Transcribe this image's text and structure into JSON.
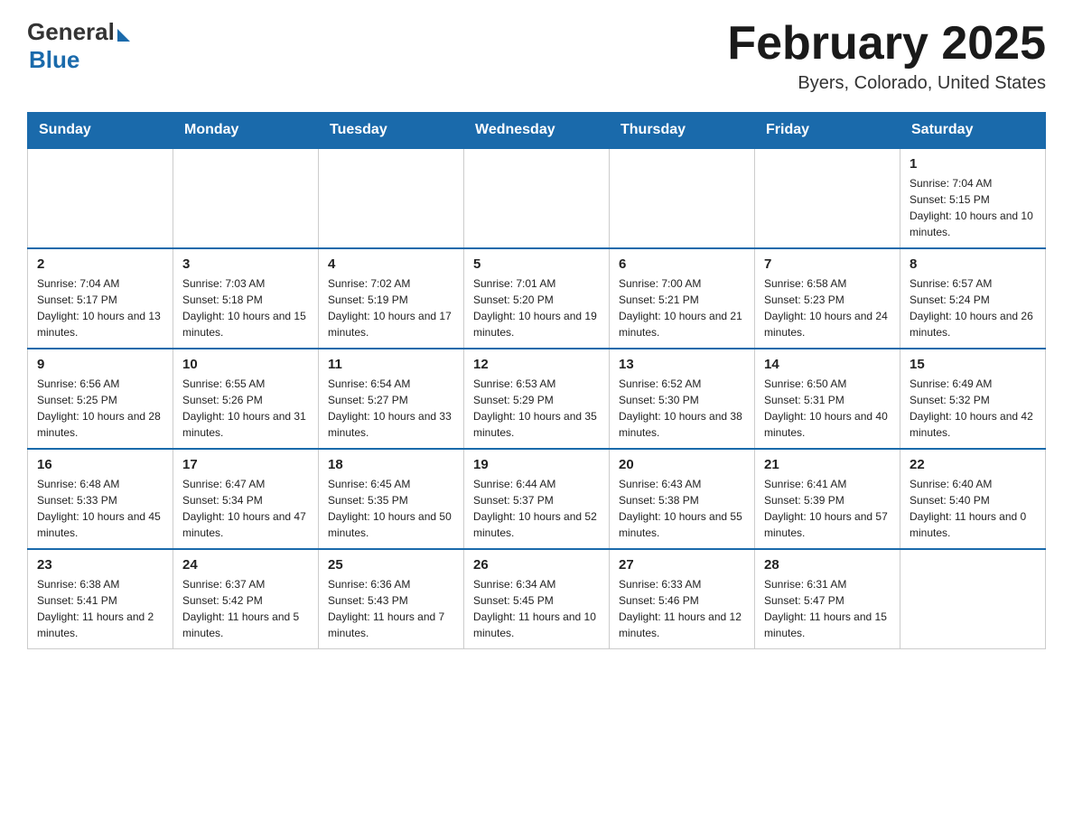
{
  "logo": {
    "general": "General",
    "blue": "Blue"
  },
  "title": "February 2025",
  "location": "Byers, Colorado, United States",
  "days_of_week": [
    "Sunday",
    "Monday",
    "Tuesday",
    "Wednesday",
    "Thursday",
    "Friday",
    "Saturday"
  ],
  "weeks": [
    [
      {
        "day": "",
        "info": ""
      },
      {
        "day": "",
        "info": ""
      },
      {
        "day": "",
        "info": ""
      },
      {
        "day": "",
        "info": ""
      },
      {
        "day": "",
        "info": ""
      },
      {
        "day": "",
        "info": ""
      },
      {
        "day": "1",
        "info": "Sunrise: 7:04 AM\nSunset: 5:15 PM\nDaylight: 10 hours and 10 minutes."
      }
    ],
    [
      {
        "day": "2",
        "info": "Sunrise: 7:04 AM\nSunset: 5:17 PM\nDaylight: 10 hours and 13 minutes."
      },
      {
        "day": "3",
        "info": "Sunrise: 7:03 AM\nSunset: 5:18 PM\nDaylight: 10 hours and 15 minutes."
      },
      {
        "day": "4",
        "info": "Sunrise: 7:02 AM\nSunset: 5:19 PM\nDaylight: 10 hours and 17 minutes."
      },
      {
        "day": "5",
        "info": "Sunrise: 7:01 AM\nSunset: 5:20 PM\nDaylight: 10 hours and 19 minutes."
      },
      {
        "day": "6",
        "info": "Sunrise: 7:00 AM\nSunset: 5:21 PM\nDaylight: 10 hours and 21 minutes."
      },
      {
        "day": "7",
        "info": "Sunrise: 6:58 AM\nSunset: 5:23 PM\nDaylight: 10 hours and 24 minutes."
      },
      {
        "day": "8",
        "info": "Sunrise: 6:57 AM\nSunset: 5:24 PM\nDaylight: 10 hours and 26 minutes."
      }
    ],
    [
      {
        "day": "9",
        "info": "Sunrise: 6:56 AM\nSunset: 5:25 PM\nDaylight: 10 hours and 28 minutes."
      },
      {
        "day": "10",
        "info": "Sunrise: 6:55 AM\nSunset: 5:26 PM\nDaylight: 10 hours and 31 minutes."
      },
      {
        "day": "11",
        "info": "Sunrise: 6:54 AM\nSunset: 5:27 PM\nDaylight: 10 hours and 33 minutes."
      },
      {
        "day": "12",
        "info": "Sunrise: 6:53 AM\nSunset: 5:29 PM\nDaylight: 10 hours and 35 minutes."
      },
      {
        "day": "13",
        "info": "Sunrise: 6:52 AM\nSunset: 5:30 PM\nDaylight: 10 hours and 38 minutes."
      },
      {
        "day": "14",
        "info": "Sunrise: 6:50 AM\nSunset: 5:31 PM\nDaylight: 10 hours and 40 minutes."
      },
      {
        "day": "15",
        "info": "Sunrise: 6:49 AM\nSunset: 5:32 PM\nDaylight: 10 hours and 42 minutes."
      }
    ],
    [
      {
        "day": "16",
        "info": "Sunrise: 6:48 AM\nSunset: 5:33 PM\nDaylight: 10 hours and 45 minutes."
      },
      {
        "day": "17",
        "info": "Sunrise: 6:47 AM\nSunset: 5:34 PM\nDaylight: 10 hours and 47 minutes."
      },
      {
        "day": "18",
        "info": "Sunrise: 6:45 AM\nSunset: 5:35 PM\nDaylight: 10 hours and 50 minutes."
      },
      {
        "day": "19",
        "info": "Sunrise: 6:44 AM\nSunset: 5:37 PM\nDaylight: 10 hours and 52 minutes."
      },
      {
        "day": "20",
        "info": "Sunrise: 6:43 AM\nSunset: 5:38 PM\nDaylight: 10 hours and 55 minutes."
      },
      {
        "day": "21",
        "info": "Sunrise: 6:41 AM\nSunset: 5:39 PM\nDaylight: 10 hours and 57 minutes."
      },
      {
        "day": "22",
        "info": "Sunrise: 6:40 AM\nSunset: 5:40 PM\nDaylight: 11 hours and 0 minutes."
      }
    ],
    [
      {
        "day": "23",
        "info": "Sunrise: 6:38 AM\nSunset: 5:41 PM\nDaylight: 11 hours and 2 minutes."
      },
      {
        "day": "24",
        "info": "Sunrise: 6:37 AM\nSunset: 5:42 PM\nDaylight: 11 hours and 5 minutes."
      },
      {
        "day": "25",
        "info": "Sunrise: 6:36 AM\nSunset: 5:43 PM\nDaylight: 11 hours and 7 minutes."
      },
      {
        "day": "26",
        "info": "Sunrise: 6:34 AM\nSunset: 5:45 PM\nDaylight: 11 hours and 10 minutes."
      },
      {
        "day": "27",
        "info": "Sunrise: 6:33 AM\nSunset: 5:46 PM\nDaylight: 11 hours and 12 minutes."
      },
      {
        "day": "28",
        "info": "Sunrise: 6:31 AM\nSunset: 5:47 PM\nDaylight: 11 hours and 15 minutes."
      },
      {
        "day": "",
        "info": ""
      }
    ]
  ]
}
